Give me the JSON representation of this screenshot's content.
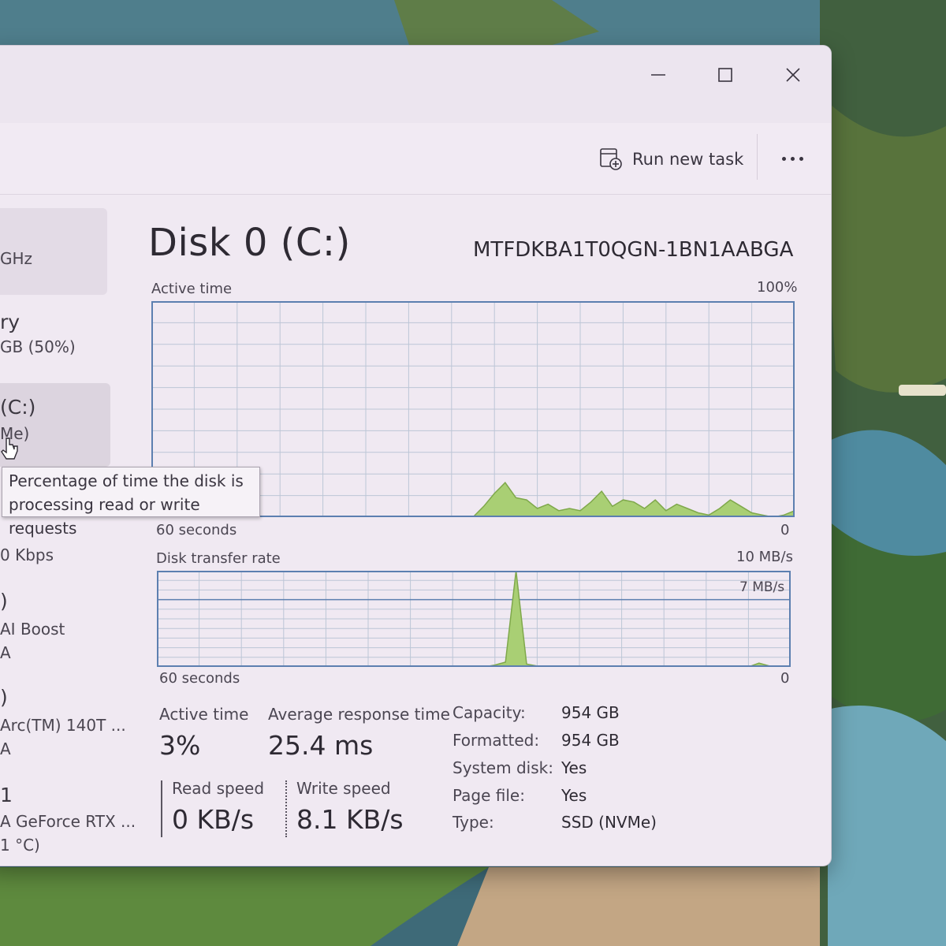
{
  "window": {
    "caption_buttons": [
      "minimize-icon",
      "maximize-icon",
      "close-icon"
    ]
  },
  "toolbar": {
    "run_new_task_label": "Run new task",
    "run_new_task_icon": "run-task-icon",
    "more_icon": "more-options-icon"
  },
  "sidebar": {
    "cpu": {
      "detail": "GHz"
    },
    "memory": {
      "title": "ry",
      "detail": "GB (50%)"
    },
    "disk": {
      "title": "(C:)",
      "detail": "Me)"
    },
    "wifi": {
      "detail": "0 Kbps"
    },
    "npu": {
      "title": ")",
      "detail": "AI Boost",
      "detail2": "A"
    },
    "gpu0": {
      "title": ")",
      "detail": "Arc(TM) 140T ...",
      "detail2": "A"
    },
    "gpu1": {
      "title": "1",
      "detail": "A GeForce RTX ...",
      "detail2": "1 °C)"
    }
  },
  "tooltip": {
    "line1": "Percentage of time the disk is",
    "line2": "processing read or write requests"
  },
  "main": {
    "title": "Disk 0 (C:)",
    "model": "MTFDKBA1T0QGN-1BN1AABGA",
    "active_chart": {
      "label": "Active time",
      "max_label": "100%",
      "time_label": "60 seconds",
      "min_label": "0"
    },
    "transfer_chart": {
      "label": "Disk transfer rate",
      "max_label": "10 MB/s",
      "ref_label": "7 MB/s",
      "time_label": "60 seconds",
      "min_label": "0"
    },
    "stats": {
      "active_time_label": "Active time",
      "active_time_value": "3%",
      "avg_response_label": "Average response time",
      "avg_response_value": "25.4 ms",
      "read_speed_label": "Read speed",
      "read_speed_value": "0 KB/s",
      "write_speed_label": "Write speed",
      "write_speed_value": "8.1 KB/s"
    },
    "properties": [
      {
        "label": "Capacity:",
        "value": "954 GB"
      },
      {
        "label": "Formatted:",
        "value": "954 GB"
      },
      {
        "label": "System disk:",
        "value": "Yes"
      },
      {
        "label": "Page file:",
        "value": "Yes"
      },
      {
        "label": "Type:",
        "value": "SSD (NVMe)"
      }
    ]
  },
  "colors": {
    "graph_border": "#5c7fb0",
    "graph_grid": "#bcc6d6",
    "graph_fill": "#a9cf74",
    "graph_line": "#7fa84b"
  },
  "chart_data": [
    {
      "type": "area",
      "title": "Active time",
      "xlabel": "60 seconds",
      "ylim": [
        0,
        100
      ],
      "x": [
        60,
        59,
        58,
        57,
        56,
        55,
        54,
        53,
        52,
        51,
        50,
        49,
        48,
        47,
        46,
        45,
        44,
        43,
        42,
        41,
        40,
        39,
        38,
        37,
        36,
        35,
        34,
        33,
        32,
        31,
        30,
        29,
        28,
        27,
        26,
        25,
        24,
        23,
        22,
        21,
        20,
        19,
        18,
        17,
        16,
        15,
        14,
        13,
        12,
        11,
        10,
        9,
        8,
        7,
        6,
        5,
        4,
        3,
        2,
        1,
        0
      ],
      "values": [
        0,
        0,
        0,
        0,
        0,
        0,
        0,
        0,
        0,
        0,
        0,
        0,
        0,
        0,
        0,
        0,
        0,
        0,
        0,
        0,
        0,
        0,
        0,
        0,
        0,
        0,
        0,
        0,
        0,
        0,
        0,
        5,
        11,
        16,
        9,
        8,
        4,
        6,
        3,
        4,
        3,
        7,
        12,
        5,
        8,
        7,
        4,
        8,
        3,
        6,
        4,
        2,
        1,
        4,
        8,
        5,
        2,
        1,
        0,
        1,
        3
      ]
    },
    {
      "type": "area",
      "title": "Disk transfer rate",
      "xlabel": "60 seconds",
      "ylim": [
        0,
        10
      ],
      "y_ref_line": 7,
      "x": [
        60,
        59,
        58,
        57,
        56,
        55,
        54,
        53,
        52,
        51,
        50,
        49,
        48,
        47,
        46,
        45,
        44,
        43,
        42,
        41,
        40,
        39,
        38,
        37,
        36,
        35,
        34,
        33,
        32,
        31,
        30,
        29,
        28,
        27,
        26,
        25,
        24,
        23,
        22,
        21,
        20,
        19,
        18,
        17,
        16,
        15,
        14,
        13,
        12,
        11,
        10,
        9,
        8,
        7,
        6,
        5,
        4,
        3,
        2,
        1,
        0
      ],
      "values": [
        0,
        0,
        0,
        0,
        0,
        0,
        0,
        0,
        0,
        0,
        0,
        0,
        0,
        0,
        0,
        0,
        0,
        0,
        0,
        0,
        0,
        0,
        0,
        0,
        0,
        0,
        0,
        0,
        0,
        0,
        0,
        0,
        0.2,
        0.5,
        10,
        0.3,
        0.1,
        0.1,
        0,
        0,
        0,
        0,
        0,
        0,
        0,
        0,
        0,
        0,
        0,
        0,
        0,
        0,
        0,
        0,
        0,
        0,
        0,
        0.4,
        0.1,
        0,
        0
      ]
    }
  ]
}
